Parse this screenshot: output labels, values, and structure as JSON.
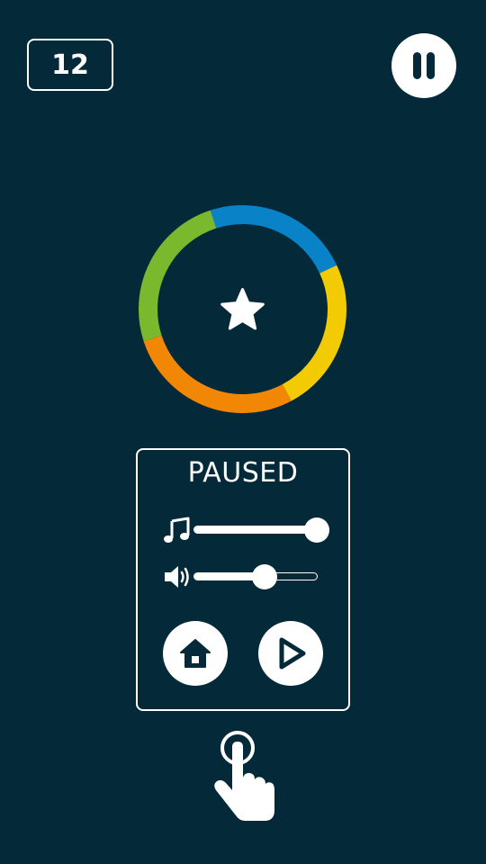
{
  "hud": {
    "score": "12",
    "pause_icon": "pause-icon"
  },
  "ring": {
    "center_icon": "star-icon",
    "colors": {
      "blue": "#0a82c8",
      "yellow": "#f2cb05",
      "orange": "#f28705",
      "green": "#7ab82e"
    }
  },
  "pause_panel": {
    "title": "PAUSED",
    "music": {
      "icon": "music-note-icon",
      "level": 1.0
    },
    "sound": {
      "icon": "speaker-icon",
      "level": 0.57
    },
    "home_icon": "home-icon",
    "play_icon": "play-icon"
  },
  "hint": {
    "icon": "tap-hand-icon"
  },
  "colors": {
    "background": "#042a3a",
    "foreground": "#ffffff"
  }
}
